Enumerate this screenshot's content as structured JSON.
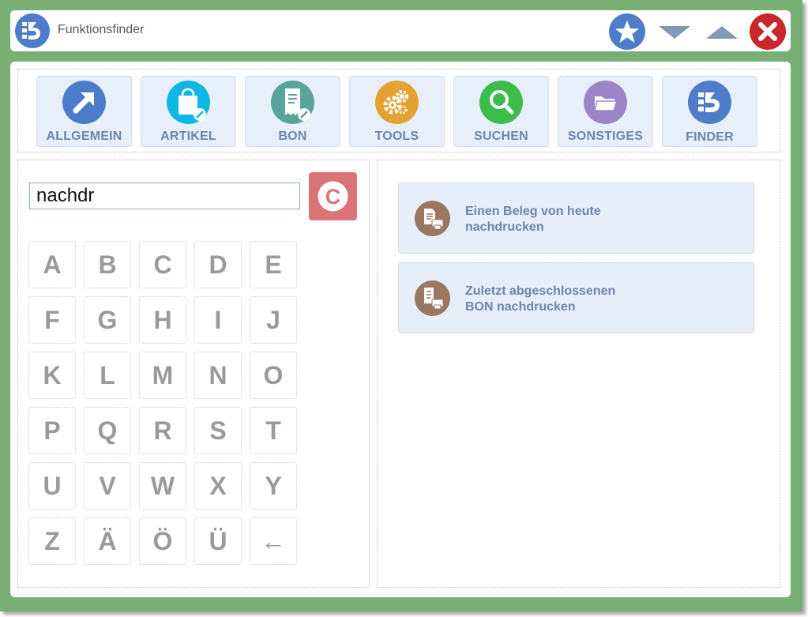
{
  "window": {
    "title": "Funktionsfinder",
    "icons": [
      "app-logo-icon",
      "star-icon",
      "chevron-down-icon",
      "chevron-up-icon",
      "close-icon"
    ],
    "colors": {
      "frame": "#78b074",
      "accent": "#4e7cc8",
      "close": "#c9272d"
    }
  },
  "toolbar": {
    "items": [
      {
        "label": "ALLGEMEIN",
        "icon": "arrow-up-right-icon",
        "color": "#4a7cc9"
      },
      {
        "label": "ARTIKEL",
        "icon": "shopping-bag-icon",
        "color": "#10b7e4"
      },
      {
        "label": "BON",
        "icon": "receipt-icon",
        "color": "#58a39c"
      },
      {
        "label": "TOOLS",
        "icon": "gears-icon",
        "color": "#e5a232"
      },
      {
        "label": "SUCHEN",
        "icon": "magnifier-icon",
        "color": "#3cbd4b"
      },
      {
        "label": "SONSTIGES",
        "icon": "folder-icon",
        "color": "#9b85c6"
      },
      {
        "label": "FINDER",
        "icon": "finder-logo-icon",
        "color": "#4e7cc8"
      }
    ]
  },
  "search": {
    "value": "nachdr",
    "clear_label": "C",
    "clear_color": "#db7479"
  },
  "keyboard": {
    "rows": [
      [
        "A",
        "B",
        "C",
        "D",
        "E"
      ],
      [
        "F",
        "G",
        "H",
        "I",
        "J"
      ],
      [
        "K",
        "L",
        "M",
        "N",
        "O"
      ],
      [
        "P",
        "Q",
        "R",
        "S",
        "T"
      ],
      [
        "U",
        "V",
        "W",
        "X",
        "Y"
      ],
      [
        "Z",
        "Ä",
        "Ö",
        "Ü",
        "←"
      ]
    ]
  },
  "results": [
    {
      "line1": "Einen Beleg von heute",
      "line2": "nachdrucken",
      "icon": "print-document-icon"
    },
    {
      "line1": "Zuletzt abgeschlossenen",
      "line2": "BON nachdrucken",
      "icon": "print-receipt-icon"
    }
  ]
}
